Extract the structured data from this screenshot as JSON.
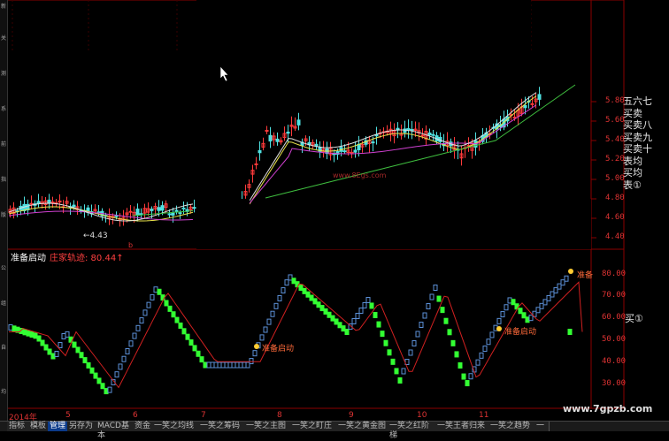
{
  "left_sidebar_labels": [
    "新",
    "关",
    "测",
    "系",
    "前",
    "指",
    "版",
    "公",
    "组",
    "自",
    "均"
  ],
  "upper_pane": {
    "y_ticks": [
      "5.80",
      "5.60",
      "5.40",
      "5.20",
      "5.00",
      "4.80",
      "4.60",
      "4.40"
    ],
    "low_marker": "4.43",
    "watermark": "www.8Egs.com",
    "right_panel_lines": [
      "五",
      "买",
      "买",
      "买",
      "买",
      "表",
      "买",
      "表"
    ],
    "right_panel_lines_col2": [
      "六",
      "卖",
      "卖",
      "卖",
      "卖",
      "均",
      "均",
      "①"
    ],
    "right_panel_lines_col3": [
      "七",
      "",
      "八",
      "九",
      "十",
      "",
      "",
      ""
    ]
  },
  "lower_pane": {
    "title": "准备启动",
    "subtitle": "庄家轨迹: 80.44",
    "y_ticks": [
      "80.00",
      "70.00",
      "60.00",
      "50.00",
      "40.00",
      "30.00"
    ],
    "signal_label": "准备启动",
    "signal_label2": "准备启动",
    "signal_label3": "准备",
    "right_marker": "买①"
  },
  "time_axis": {
    "labels": [
      "2014年",
      "5",
      "6",
      "7",
      "8",
      "9",
      "10",
      "11"
    ]
  },
  "bottom_tabs": [
    "指标",
    "模板",
    "管理",
    "另存为",
    "MACD基本",
    "资金",
    "一笑之均线",
    "一笑之筹码",
    "一笑之主图",
    "一笑之盯庄",
    "一笑之黄金图",
    "一笑之红阶梯",
    "一笑王者归来",
    "一笑之趋势",
    "一"
  ],
  "active_tab_index": 2,
  "site_watermark": "www.7gpzb.com",
  "colors": {
    "bg": "#000000",
    "grid": "#8b0000",
    "axis_text": "#d33333",
    "up_candle": "#ff3a3a",
    "down_candle": "#4fe0e0",
    "ma_yellow": "#e8e24a",
    "ma_magenta": "#d040d0",
    "ma_green": "#3fbf3f",
    "ma_white": "#e0e0e0",
    "bar_blue": "#5b8fd6",
    "bar_green": "#33ff33",
    "curve_red": "#d02020"
  }
}
